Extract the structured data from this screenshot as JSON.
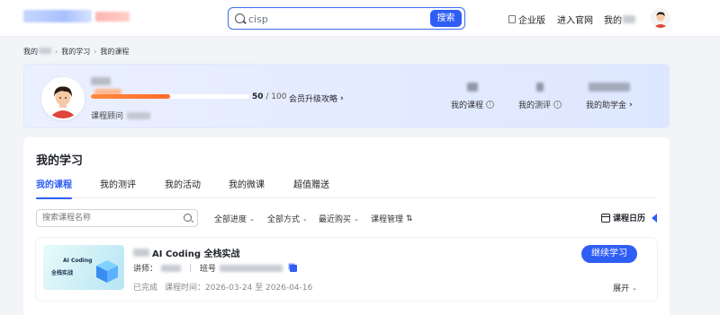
{
  "header": {
    "search_value": "cisp",
    "search_button": "搜索",
    "nav_enterprise": "企业版",
    "nav_official": "进入官网",
    "nav_my": "我的"
  },
  "breadcrumb": [
    "我的",
    "我的学习",
    "我的课程"
  ],
  "profile": {
    "progress_value": 50,
    "progress_total": "/ 100",
    "upgrade_link": "会员升级攻略",
    "advisor_label": "课程顾问",
    "stats": [
      {
        "label": "我的课程"
      },
      {
        "label": "我的测评"
      },
      {
        "label": "我的助学金"
      }
    ]
  },
  "main": {
    "title": "我的学习",
    "tabs": [
      "我的课程",
      "我的测评",
      "我的活动",
      "我的微课",
      "超值赠送"
    ],
    "search_placeholder": "搜索课程名称",
    "filters": [
      "全部进度",
      "全部方式",
      "最近购买",
      "课程管理"
    ],
    "calendar": "课程日历"
  },
  "course": {
    "title": "AI Coding 全栈实战",
    "thumb_line1": "AI Coding",
    "thumb_line2": "全栈实战",
    "teacher_label": "讲师：",
    "class_label": "班号",
    "status": "已完成",
    "time_label": "课程时间：",
    "time_value": "2026-03-24 至 2026-04-16",
    "continue_button": "继续学习",
    "expand": "展开"
  },
  "colors": {
    "accent": "#2f5ef5",
    "progress": "#ff6b2c"
  }
}
